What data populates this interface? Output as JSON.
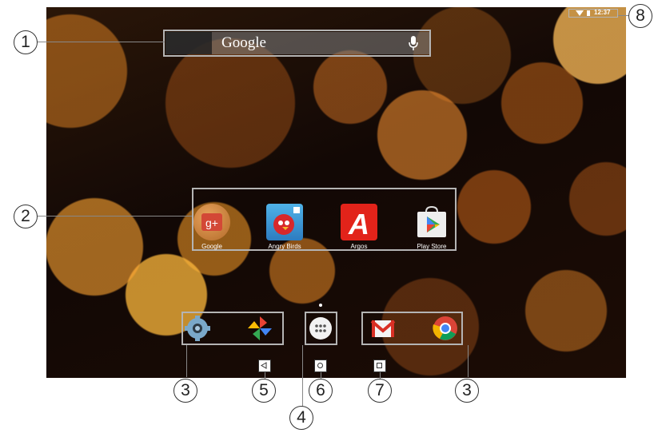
{
  "status_bar": {
    "time": "12:37"
  },
  "search": {
    "brand": "Google",
    "mic_icon": "mic-icon"
  },
  "apps": [
    {
      "label": "Google",
      "icon": "google-plus-icon"
    },
    {
      "label": "Angry Birds",
      "icon": "angry-birds-icon"
    },
    {
      "label": "Argos",
      "icon": "argos-icon"
    },
    {
      "label": "Play Store",
      "icon": "play-store-icon"
    }
  ],
  "dock": {
    "left": [
      "settings-icon",
      "photos-icon"
    ],
    "center": "all-apps-icon",
    "right": [
      "gmail-icon",
      "chrome-icon"
    ]
  },
  "nav": [
    "back-icon",
    "home-icon",
    "recents-icon"
  ],
  "callouts": [
    "1",
    "2",
    "3",
    "4",
    "5",
    "6",
    "7",
    "3",
    "8"
  ],
  "colors": {
    "frame": "#b4b4b4",
    "argos_red": "#e2231a",
    "gmail_red": "#d93025"
  }
}
